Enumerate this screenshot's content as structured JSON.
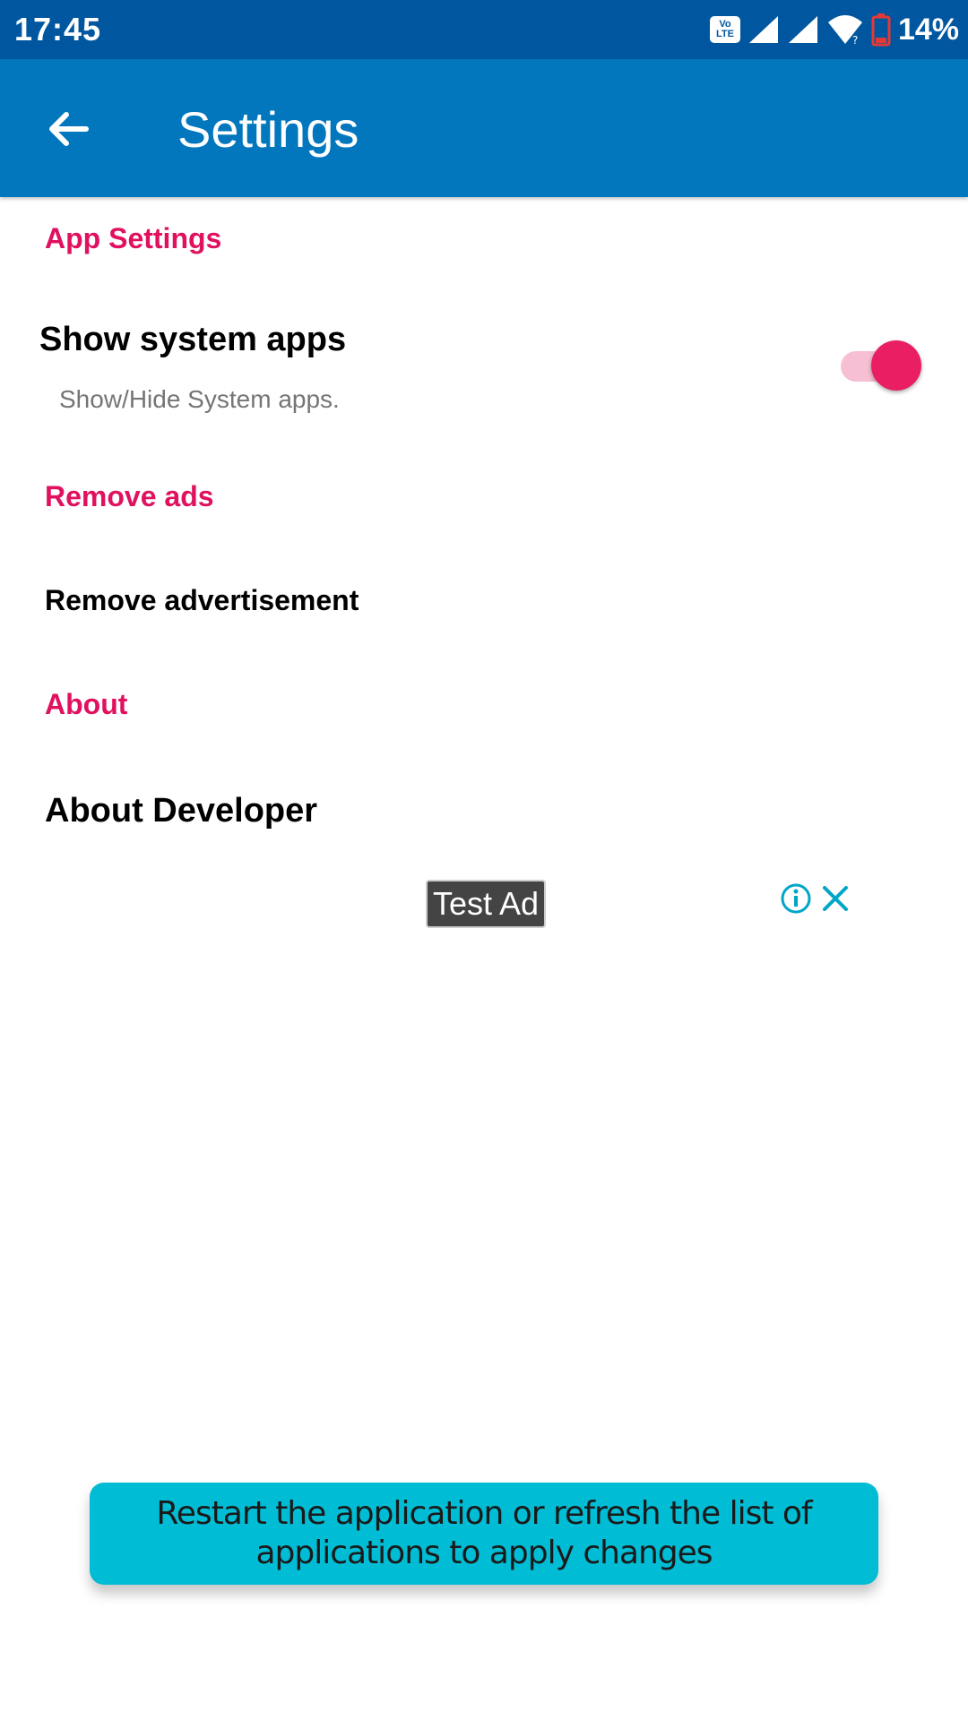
{
  "status_bar": {
    "time": "17:45",
    "volte_label_top": "Vo",
    "volte_label_bottom": "LTE",
    "battery_percent": "14%",
    "icons": [
      "volte-icon",
      "signal-icon",
      "signal-icon",
      "wifi-icon",
      "battery-low-icon"
    ]
  },
  "app_bar": {
    "title": "Settings",
    "back_icon": "arrow-back-icon",
    "color": "#0277bd"
  },
  "sections": {
    "app_settings": {
      "header": "App Settings",
      "show_system_apps": {
        "title": "Show system apps",
        "summary": "Show/Hide System apps.",
        "enabled": true
      }
    },
    "remove_ads": {
      "header": "Remove ads",
      "item_title": "Remove advertisement"
    },
    "about": {
      "header": "About",
      "item_title": "About Developer"
    }
  },
  "ad": {
    "label": "Test Ad",
    "info_icon": "info-icon",
    "close_icon": "close-icon"
  },
  "toast": {
    "message": "Restart the application or refresh the list of applications to apply changes"
  },
  "colors": {
    "status_bar": "#0057a0",
    "accent": "#e0115f",
    "toast": "#00bcd4"
  }
}
